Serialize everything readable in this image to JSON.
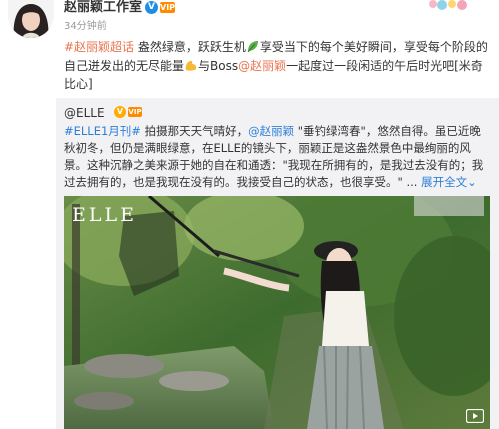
{
  "post": {
    "author": "赵丽颖工作室",
    "verified_mark": "V",
    "vip_mark": "VIP",
    "timestamp": "34分钟前",
    "text": {
      "topic": "#赵丽颖超话",
      "body_1": " 盎然绿意，跃跃生机",
      "body_2": "享受当下的每个美好瞬间，享受每个阶段的自己迸发出的无尽能量",
      "body_3": "与Boss",
      "mention": "@赵丽颖",
      "body_4": "一起度过一段闲适的午后时光吧[米奇比心]"
    }
  },
  "repost": {
    "author": "@ELLE",
    "verified_mark": "V",
    "vip_mark": "VIP",
    "text": {
      "topic": "#ELLE1月刊#",
      "body_1": " 拍摄那天天气晴好，",
      "mention": "@赵丽颖",
      "body_2": " \"垂钓绿湾春\"，悠然自得。虽已近晚秋初冬，但仍是满眼绿意，在ELLE的镜头下，丽颖正是这盎然景色中最绚丽的风景。这种沉静之美来源于她的自在和通透：\"我现在所拥有的，是我过去没有的；我过去拥有的，也是我现在没有的。我接受自己的状态，也很享受。\" ...",
      "expand_label": "展开全文",
      "expand_arrow": "⌄"
    },
    "image": {
      "logo": "ELLE"
    }
  },
  "icons": {
    "emoji_leaf": "leaf-emoji-icon",
    "emoji_muscle": "muscle-emoji-icon",
    "video": "video-play-icon"
  },
  "colors": {
    "link_orange": "#eb7350",
    "link_blue": "#2b7fd6",
    "repost_bg": "#f2f2f5",
    "verified_blue": "#1f8fe6"
  }
}
